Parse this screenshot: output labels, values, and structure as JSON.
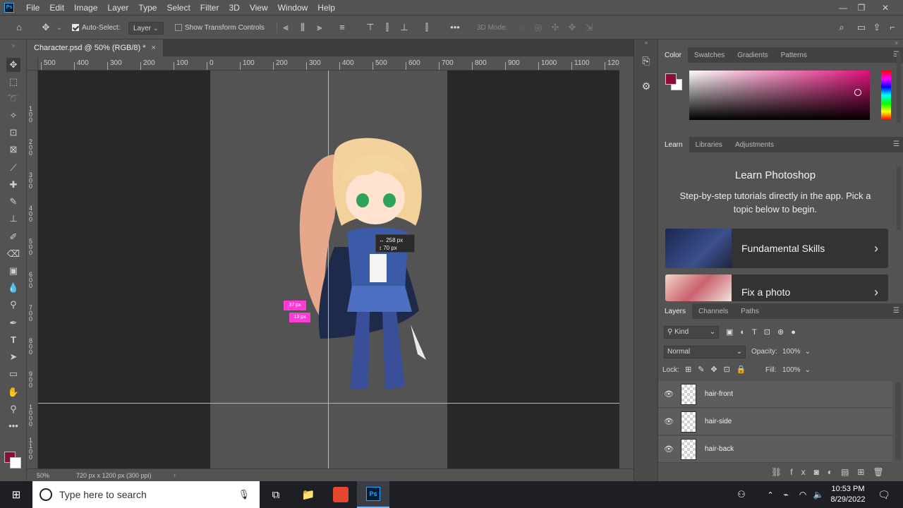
{
  "app": {
    "logo": "Ps"
  },
  "menu": [
    "File",
    "Edit",
    "Image",
    "Layer",
    "Type",
    "Select",
    "Filter",
    "3D",
    "View",
    "Window",
    "Help"
  ],
  "options_bar": {
    "auto_select_label": "Auto-Select:",
    "auto_select_checked": true,
    "auto_select_target": "Layer",
    "show_transform_label": "Show Transform Controls",
    "mode_3d_label": "3D Mode:"
  },
  "document": {
    "tab_title": "Character.psd @ 50% (RGB/8) *",
    "zoom": "50%",
    "doc_info": "720 px x 1200 px (300 ppi)"
  },
  "rulers": {
    "horizontal_labels": [
      "500",
      "400",
      "300",
      "200",
      "100",
      "0",
      "100",
      "200",
      "300",
      "400",
      "500",
      "600",
      "700",
      "800",
      "900",
      "1000",
      "1100",
      "120"
    ],
    "vertical_labels": [
      "1\n0\n0",
      "2\n0\n0",
      "3\n0\n0",
      "4\n0\n0",
      "5\n0\n0",
      "6\n0\n0",
      "7\n0\n0",
      "8\n0\n0",
      "9\n0\n0",
      "1\n0\n0\n0",
      "1\n1\n0\n0"
    ]
  },
  "canvas": {
    "measure_tooltip": {
      "w": "258 px",
      "h": "70 px"
    },
    "spacing_badges": [
      "37 px",
      "13 px"
    ]
  },
  "panels": {
    "color_tabs": [
      "Color",
      "Swatches",
      "Gradients",
      "Patterns"
    ],
    "foreground_color": "#8c0c3c",
    "background_color": "#ffffff",
    "learn_tabs": [
      "Learn",
      "Libraries",
      "Adjustments"
    ],
    "learn_title": "Learn Photoshop",
    "learn_subtitle": "Step-by-step tutorials directly in the app. Pick a topic below to begin.",
    "learn_cards": [
      "Fundamental Skills",
      "Fix a photo"
    ],
    "layers_tabs": [
      "Layers",
      "Channels",
      "Paths"
    ],
    "filter_kind": "Kind",
    "blend_mode": "Normal",
    "opacity_label": "Opacity:",
    "opacity_value": "100%",
    "lock_label": "Lock:",
    "fill_label": "Fill:",
    "fill_value": "100%",
    "layers": [
      "hair-front",
      "hair-side",
      "hair-back"
    ]
  },
  "taskbar": {
    "search_placeholder": "Type here to search",
    "time": "10:53 PM",
    "date": "8/29/2022"
  }
}
